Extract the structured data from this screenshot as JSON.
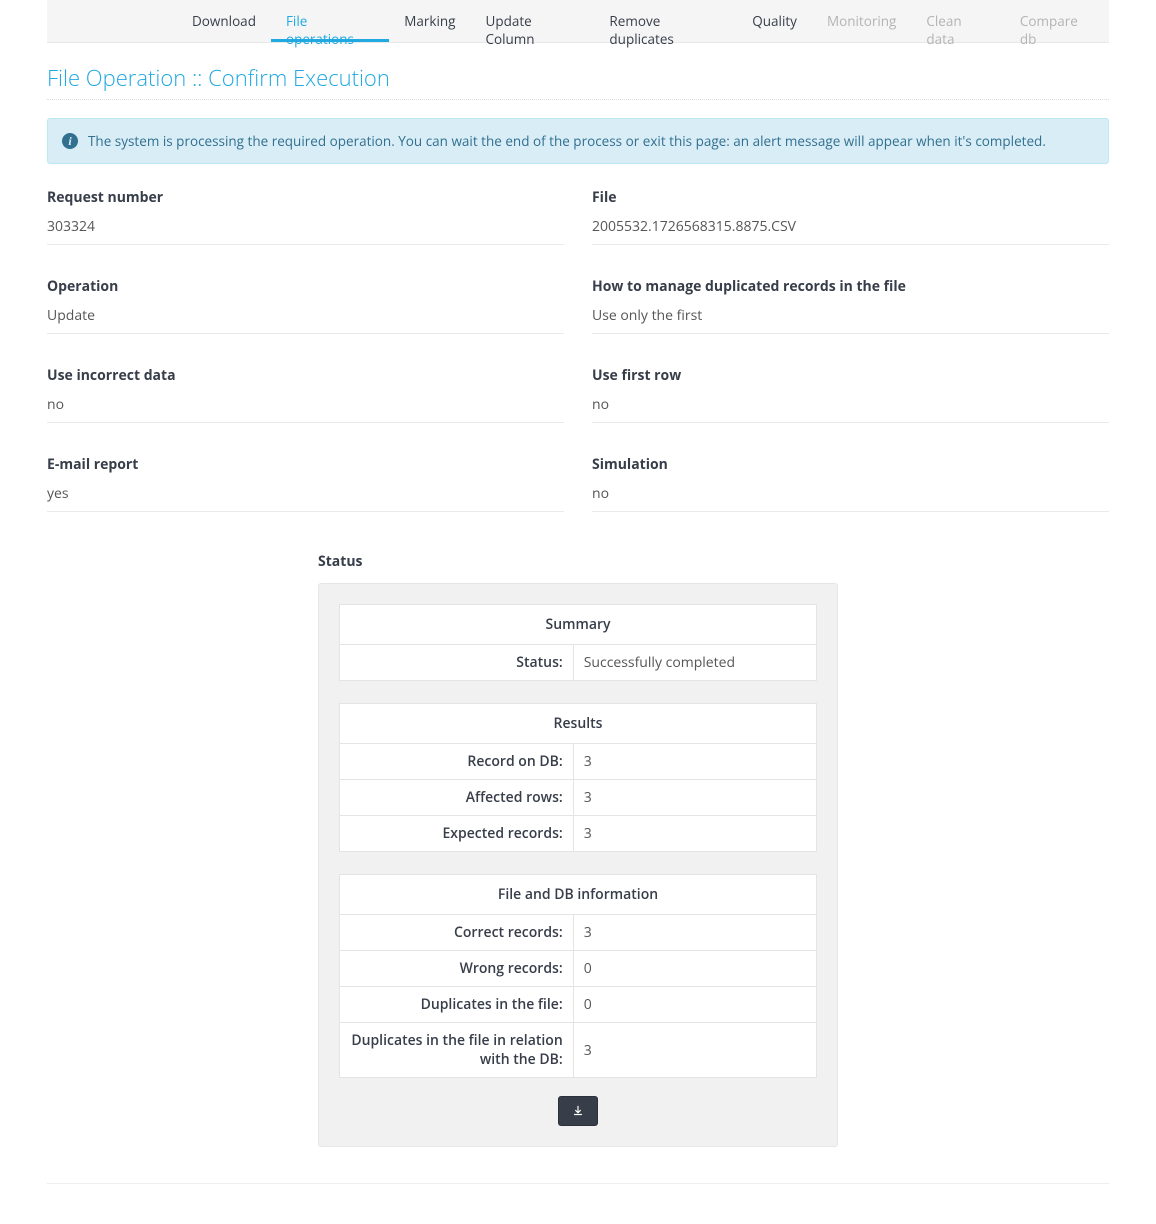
{
  "tabs": {
    "download": "Download",
    "file_ops": "File operations",
    "marking": "Marking",
    "update_column": "Update Column",
    "remove_dup": "Remove duplicates",
    "quality": "Quality",
    "monitoring": "Monitoring",
    "clean_data": "Clean data",
    "compare_db": "Compare db"
  },
  "page_title": "File Operation :: Confirm Execution",
  "alert": {
    "message": "The system is processing the required operation. You can wait the end of the process or exit this page: an alert message will appear when it's completed."
  },
  "fields": {
    "request_number": {
      "label": "Request number",
      "value": "303324"
    },
    "file": {
      "label": "File",
      "value": "2005532.1726568315.8875.CSV"
    },
    "operation": {
      "label": "Operation",
      "value": "Update"
    },
    "manage_dup": {
      "label": "How to manage duplicated records in the file",
      "value": "Use only the first"
    },
    "use_incorrect": {
      "label": "Use incorrect data",
      "value": "no"
    },
    "use_first_row": {
      "label": "Use first row",
      "value": "no"
    },
    "email_report": {
      "label": "E-mail report",
      "value": "yes"
    },
    "simulation": {
      "label": "Simulation",
      "value": "no"
    }
  },
  "status": {
    "heading": "Status",
    "summary": {
      "title": "Summary",
      "status_label": "Status:",
      "status_value": "Successfully completed"
    },
    "results": {
      "title": "Results",
      "record_on_db": {
        "label": "Record on DB:",
        "value": "3"
      },
      "affected_rows": {
        "label": "Affected rows:",
        "value": "3"
      },
      "expected_records": {
        "label": "Expected records:",
        "value": "3"
      }
    },
    "file_db": {
      "title": "File and DB information",
      "correct_records": {
        "label": "Correct records:",
        "value": "3"
      },
      "wrong_records": {
        "label": "Wrong records:",
        "value": "0"
      },
      "dup_in_file": {
        "label": "Duplicates in the file:",
        "value": "0"
      },
      "dup_file_vs_db": {
        "label": "Duplicates in the file in relation with the DB:",
        "value": "3"
      }
    }
  }
}
